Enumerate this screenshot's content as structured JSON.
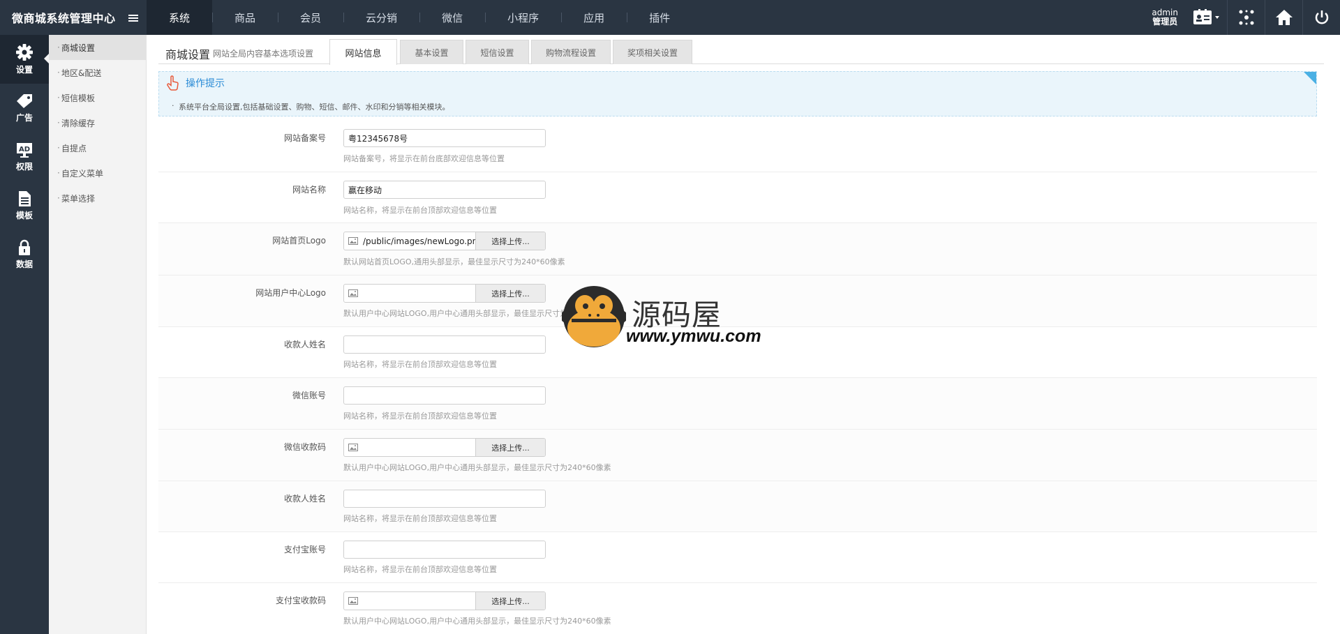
{
  "brand": {
    "title": "微商城系统管理中心"
  },
  "topnav": [
    {
      "label": "系统",
      "active": true
    },
    {
      "label": "商品"
    },
    {
      "label": "会员"
    },
    {
      "label": "云分销"
    },
    {
      "label": "微信"
    },
    {
      "label": "小程序"
    },
    {
      "label": "应用"
    },
    {
      "label": "插件"
    }
  ],
  "user": {
    "name": "admin",
    "role": "管理员"
  },
  "leftbar": [
    {
      "label": "设置",
      "icon": "gear-icon"
    },
    {
      "label": "广告",
      "icon": "tag-icon"
    },
    {
      "label": "权限",
      "icon": "ad-icon"
    },
    {
      "label": "模板",
      "icon": "document-icon"
    },
    {
      "label": "数据",
      "icon": "lock-icon"
    }
  ],
  "subbar": [
    {
      "label": "商城设置"
    },
    {
      "label": "地区&配送"
    },
    {
      "label": "短信模板"
    },
    {
      "label": "清除缓存"
    },
    {
      "label": "自提点"
    },
    {
      "label": "自定义菜单"
    },
    {
      "label": "菜单选择"
    }
  ],
  "page": {
    "title": "商城设置",
    "subtitle": "网站全局内容基本选项设置"
  },
  "tabs": [
    {
      "label": "网站信息"
    },
    {
      "label": "基本设置"
    },
    {
      "label": "短信设置"
    },
    {
      "label": "购物流程设置"
    },
    {
      "label": "奖项相关设置"
    }
  ],
  "tips": {
    "title": "操作提示",
    "line": "系统平台全局设置,包括基础设置、购物、短信、邮件、水印和分销等相关模块。"
  },
  "upload_label": "选择上传...",
  "form": [
    {
      "label": "网站备案号",
      "value": "粤12345678号",
      "hint": "网站备案号，将显示在前台底部欢迎信息等位置"
    },
    {
      "label": "网站名称",
      "value": "赢在移动",
      "hint": "网站名称，将显示在前台顶部欢迎信息等位置"
    },
    {
      "label": "网站首页Logo",
      "value": "/public/images/newLogo.png",
      "hint": "默认网站首页LOGO,通用头部显示，最佳显示尺寸为240*60像素"
    },
    {
      "label": "网站用户中心Logo",
      "value": "",
      "hint": "默认用户中心网站LOGO,用户中心通用头部显示，最佳显示尺寸为240*60像素"
    },
    {
      "label": "收款人姓名",
      "value": "",
      "hint": "网站名称，将显示在前台顶部欢迎信息等位置"
    },
    {
      "label": "微信账号",
      "value": "",
      "hint": "网站名称，将显示在前台顶部欢迎信息等位置"
    },
    {
      "label": "微信收款码",
      "value": "",
      "hint": "默认用户中心网站LOGO,用户中心通用头部显示，最佳显示尺寸为240*60像素"
    },
    {
      "label": "收款人姓名",
      "value": "",
      "hint": "网站名称，将显示在前台顶部欢迎信息等位置"
    },
    {
      "label": "支付宝账号",
      "value": "",
      "hint": "网站名称，将显示在前台顶部欢迎信息等位置"
    },
    {
      "label": "支付宝收款码",
      "value": "",
      "hint": "默认用户中心网站LOGO,用户中心通用头部显示，最佳显示尺寸为240*60像素"
    }
  ],
  "watermark": {
    "title": "源码屋",
    "url": "www.ymwu.com"
  },
  "colors": {
    "topbar": "#2a3542",
    "accent": "#2a8bd6",
    "tips_bg": "#eaf5fb"
  }
}
